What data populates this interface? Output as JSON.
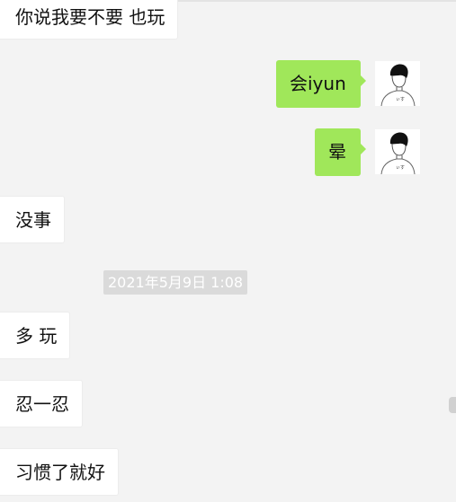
{
  "messages": [
    {
      "side": "incoming",
      "text": "你说我要不要 也玩"
    },
    {
      "side": "outgoing",
      "text": "会iyun"
    },
    {
      "side": "outgoing",
      "text": "晕"
    },
    {
      "side": "incoming",
      "text": "没事"
    },
    {
      "side": "incoming",
      "text": "多 玩"
    },
    {
      "side": "incoming",
      "text": "忍一忍"
    },
    {
      "side": "incoming",
      "text": "习惯了就好"
    }
  ],
  "timestamp": "2021年5月9日 1:08",
  "avatar": {
    "shirt_text": "ぃす"
  },
  "colors": {
    "background": "#f3f3f3",
    "incoming_bubble": "#ffffff",
    "outgoing_bubble": "#a0e75a",
    "timestamp_bg": "#dadada"
  }
}
